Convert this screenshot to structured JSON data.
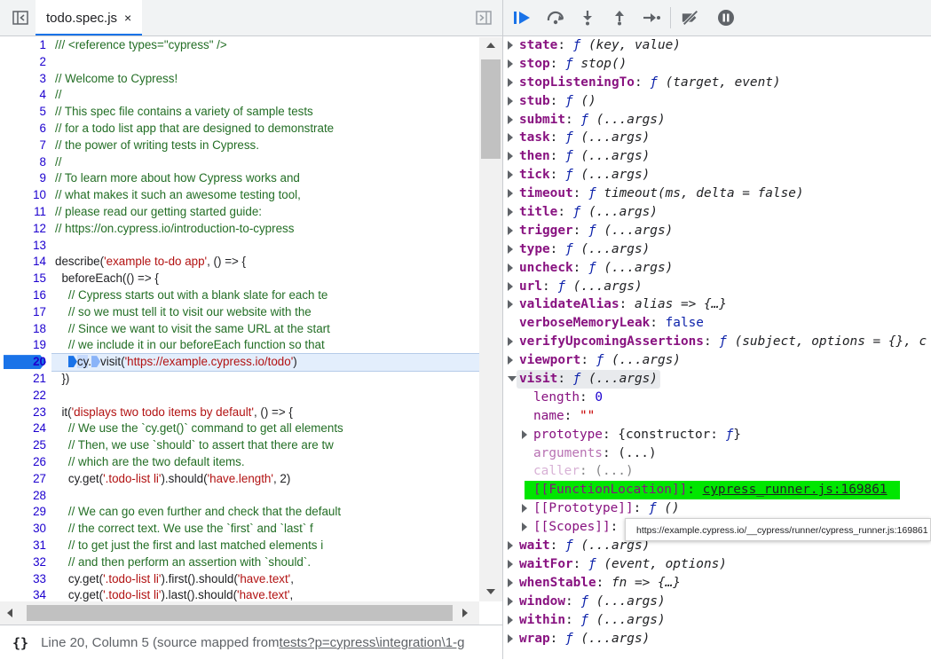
{
  "editor": {
    "tab_name": "todo.spec.js",
    "tab_close": "×",
    "breakpoint_line": 20,
    "lines": [
      {
        "n": "1",
        "parts": [
          {
            "t": "/// <reference types=\"cypress\" />",
            "c": "cm"
          }
        ]
      },
      {
        "n": "2",
        "parts": []
      },
      {
        "n": "3",
        "parts": [
          {
            "t": "// Welcome to Cypress!",
            "c": "cm"
          }
        ]
      },
      {
        "n": "4",
        "parts": [
          {
            "t": "//",
            "c": "cm"
          }
        ]
      },
      {
        "n": "5",
        "parts": [
          {
            "t": "// This spec file contains a variety of sample tests",
            "c": "cm"
          }
        ]
      },
      {
        "n": "6",
        "parts": [
          {
            "t": "// for a todo list app that are designed to demonstrate",
            "c": "cm"
          }
        ]
      },
      {
        "n": "7",
        "parts": [
          {
            "t": "// the power of writing tests in Cypress.",
            "c": "cm"
          }
        ]
      },
      {
        "n": "8",
        "parts": [
          {
            "t": "//",
            "c": "cm"
          }
        ]
      },
      {
        "n": "9",
        "parts": [
          {
            "t": "// To learn more about how Cypress works and",
            "c": "cm"
          }
        ]
      },
      {
        "n": "10",
        "parts": [
          {
            "t": "// what makes it such an awesome testing tool,",
            "c": "cm"
          }
        ]
      },
      {
        "n": "11",
        "parts": [
          {
            "t": "// please read our getting started guide:",
            "c": "cm"
          }
        ]
      },
      {
        "n": "12",
        "parts": [
          {
            "t": "// https://on.cypress.io/introduction-to-cypress",
            "c": "cm"
          }
        ]
      },
      {
        "n": "13",
        "parts": []
      },
      {
        "n": "14",
        "parts": [
          {
            "t": "describe(",
            "c": ""
          },
          {
            "t": "'example to-do app'",
            "c": "str"
          },
          {
            "t": ", () => {",
            "c": ""
          }
        ]
      },
      {
        "n": "15",
        "parts": [
          {
            "t": "  beforeEach(() => {",
            "c": ""
          }
        ]
      },
      {
        "n": "16",
        "parts": [
          {
            "t": "    // Cypress starts out with a blank slate for each te",
            "c": "cm"
          }
        ]
      },
      {
        "n": "17",
        "parts": [
          {
            "t": "    // so we must tell it to visit our website with the",
            "c": "cm"
          }
        ]
      },
      {
        "n": "18",
        "parts": [
          {
            "t": "    // Since we want to visit the same URL at the start",
            "c": "cm"
          }
        ]
      },
      {
        "n": "19",
        "parts": [
          {
            "t": "    // we include it in our beforeEach function so that",
            "c": "cm"
          }
        ]
      },
      {
        "n": "20",
        "parts": [
          {
            "t": "    ",
            "c": ""
          },
          {
            "t": "",
            "c": "marker hl"
          },
          {
            "t": "cy",
            "c": "hlcy"
          },
          {
            "t": ".",
            "c": ""
          },
          {
            "t": "",
            "c": "marker"
          },
          {
            "t": "visit(",
            "c": ""
          },
          {
            "t": "'https://example.cypress.io/todo'",
            "c": "str"
          },
          {
            "t": ")",
            "c": ""
          }
        ],
        "current": true
      },
      {
        "n": "21",
        "parts": [
          {
            "t": "  })",
            "c": ""
          }
        ]
      },
      {
        "n": "22",
        "parts": []
      },
      {
        "n": "23",
        "parts": [
          {
            "t": "  it(",
            "c": ""
          },
          {
            "t": "'displays two todo items by default'",
            "c": "str"
          },
          {
            "t": ", () => {",
            "c": ""
          }
        ]
      },
      {
        "n": "24",
        "parts": [
          {
            "t": "    // We use the `cy.get()` command to get all elements",
            "c": "cm"
          }
        ]
      },
      {
        "n": "25",
        "parts": [
          {
            "t": "    // Then, we use `should` to assert that there are tw",
            "c": "cm"
          }
        ]
      },
      {
        "n": "26",
        "parts": [
          {
            "t": "    // which are the two default items.",
            "c": "cm"
          }
        ]
      },
      {
        "n": "27",
        "parts": [
          {
            "t": "    cy.get(",
            "c": ""
          },
          {
            "t": "'.todo-list li'",
            "c": "str"
          },
          {
            "t": ").should(",
            "c": ""
          },
          {
            "t": "'have.length'",
            "c": "str"
          },
          {
            "t": ", 2)",
            "c": ""
          }
        ]
      },
      {
        "n": "28",
        "parts": []
      },
      {
        "n": "29",
        "parts": [
          {
            "t": "    // We can go even further and check that the default",
            "c": "cm"
          }
        ]
      },
      {
        "n": "30",
        "parts": [
          {
            "t": "    // the correct text. We use the `first` and `last` f",
            "c": "cm"
          }
        ]
      },
      {
        "n": "31",
        "parts": [
          {
            "t": "    // to get just the first and last matched elements i",
            "c": "cm"
          }
        ]
      },
      {
        "n": "32",
        "parts": [
          {
            "t": "    // and then perform an assertion with `should`.",
            "c": "cm"
          }
        ]
      },
      {
        "n": "33",
        "parts": [
          {
            "t": "    cy.get(",
            "c": ""
          },
          {
            "t": "'.todo-list li'",
            "c": "str"
          },
          {
            "t": ").first().should(",
            "c": ""
          },
          {
            "t": "'have.text'",
            "c": "str"
          },
          {
            "t": ", ",
            "c": ""
          }
        ]
      },
      {
        "n": "34",
        "parts": [
          {
            "t": "    cy.get(",
            "c": ""
          },
          {
            "t": "'.todo-list li'",
            "c": "str"
          },
          {
            "t": ").last().should(",
            "c": ""
          },
          {
            "t": "'have.text'",
            "c": "str"
          },
          {
            "t": ", ",
            "c": ""
          }
        ]
      }
    ]
  },
  "status": {
    "braces": "{}",
    "position": "Line 20, Column 5",
    "mapped_prefix": "(source mapped from ",
    "mapped_link": "tests?p=cypress\\integration\\1-g"
  },
  "scope": {
    "rows": [
      {
        "indent": 0,
        "tri": "r",
        "parts": [
          {
            "t": "state",
            "c": "k"
          },
          {
            "t": ": ",
            "c": ""
          },
          {
            "t": "ƒ",
            "c": "f"
          },
          {
            "t": " (key, value)",
            "c": "sig"
          }
        ]
      },
      {
        "indent": 0,
        "tri": "r",
        "parts": [
          {
            "t": "stop",
            "c": "k"
          },
          {
            "t": ": ",
            "c": ""
          },
          {
            "t": "ƒ",
            "c": "f"
          },
          {
            "t": " stop()",
            "c": "sig"
          }
        ]
      },
      {
        "indent": 0,
        "tri": "r",
        "parts": [
          {
            "t": "stopListeningTo",
            "c": "k"
          },
          {
            "t": ": ",
            "c": ""
          },
          {
            "t": "ƒ",
            "c": "f"
          },
          {
            "t": " (target, event)",
            "c": "sig"
          }
        ]
      },
      {
        "indent": 0,
        "tri": "r",
        "parts": [
          {
            "t": "stub",
            "c": "k"
          },
          {
            "t": ": ",
            "c": ""
          },
          {
            "t": "ƒ",
            "c": "f"
          },
          {
            "t": " ()",
            "c": "sig"
          }
        ]
      },
      {
        "indent": 0,
        "tri": "r",
        "parts": [
          {
            "t": "submit",
            "c": "k"
          },
          {
            "t": ": ",
            "c": ""
          },
          {
            "t": "ƒ",
            "c": "f"
          },
          {
            "t": " (...args)",
            "c": "sig"
          }
        ]
      },
      {
        "indent": 0,
        "tri": "r",
        "parts": [
          {
            "t": "task",
            "c": "k"
          },
          {
            "t": ": ",
            "c": ""
          },
          {
            "t": "ƒ",
            "c": "f"
          },
          {
            "t": " (...args)",
            "c": "sig"
          }
        ]
      },
      {
        "indent": 0,
        "tri": "r",
        "parts": [
          {
            "t": "then",
            "c": "k"
          },
          {
            "t": ": ",
            "c": ""
          },
          {
            "t": "ƒ",
            "c": "f"
          },
          {
            "t": " (...args)",
            "c": "sig"
          }
        ]
      },
      {
        "indent": 0,
        "tri": "r",
        "parts": [
          {
            "t": "tick",
            "c": "k"
          },
          {
            "t": ": ",
            "c": ""
          },
          {
            "t": "ƒ",
            "c": "f"
          },
          {
            "t": " (...args)",
            "c": "sig"
          }
        ]
      },
      {
        "indent": 0,
        "tri": "r",
        "parts": [
          {
            "t": "timeout",
            "c": "k"
          },
          {
            "t": ": ",
            "c": ""
          },
          {
            "t": "ƒ",
            "c": "f"
          },
          {
            "t": " timeout(ms, delta = false)",
            "c": "sig"
          }
        ]
      },
      {
        "indent": 0,
        "tri": "r",
        "parts": [
          {
            "t": "title",
            "c": "k"
          },
          {
            "t": ": ",
            "c": ""
          },
          {
            "t": "ƒ",
            "c": "f"
          },
          {
            "t": " (...args)",
            "c": "sig"
          }
        ]
      },
      {
        "indent": 0,
        "tri": "r",
        "parts": [
          {
            "t": "trigger",
            "c": "k"
          },
          {
            "t": ": ",
            "c": ""
          },
          {
            "t": "ƒ",
            "c": "f"
          },
          {
            "t": " (...args)",
            "c": "sig"
          }
        ]
      },
      {
        "indent": 0,
        "tri": "r",
        "parts": [
          {
            "t": "type",
            "c": "k"
          },
          {
            "t": ": ",
            "c": ""
          },
          {
            "t": "ƒ",
            "c": "f"
          },
          {
            "t": " (...args)",
            "c": "sig"
          }
        ]
      },
      {
        "indent": 0,
        "tri": "r",
        "parts": [
          {
            "t": "uncheck",
            "c": "k"
          },
          {
            "t": ": ",
            "c": ""
          },
          {
            "t": "ƒ",
            "c": "f"
          },
          {
            "t": " (...args)",
            "c": "sig"
          }
        ]
      },
      {
        "indent": 0,
        "tri": "r",
        "parts": [
          {
            "t": "url",
            "c": "k"
          },
          {
            "t": ": ",
            "c": ""
          },
          {
            "t": "ƒ",
            "c": "f"
          },
          {
            "t": " (...args)",
            "c": "sig"
          }
        ]
      },
      {
        "indent": 0,
        "tri": "r",
        "parts": [
          {
            "t": "validateAlias",
            "c": "k"
          },
          {
            "t": ": ",
            "c": ""
          },
          {
            "t": "alias => {…}",
            "c": "sig"
          }
        ]
      },
      {
        "indent": 0,
        "tri": "",
        "parts": [
          {
            "t": "verboseMemoryLeak",
            "c": "k"
          },
          {
            "t": ": ",
            "c": ""
          },
          {
            "t": "false",
            "c": "kw"
          }
        ]
      },
      {
        "indent": 0,
        "tri": "r",
        "parts": [
          {
            "t": "verifyUpcomingAssertions",
            "c": "k"
          },
          {
            "t": ": ",
            "c": ""
          },
          {
            "t": "ƒ",
            "c": "f"
          },
          {
            "t": " (subject, options = {}, c",
            "c": "sig"
          }
        ]
      },
      {
        "indent": 0,
        "tri": "r",
        "parts": [
          {
            "t": "viewport",
            "c": "k"
          },
          {
            "t": ": ",
            "c": ""
          },
          {
            "t": "ƒ",
            "c": "f"
          },
          {
            "t": " (...args)",
            "c": "sig"
          }
        ]
      },
      {
        "indent": 0,
        "tri": "d",
        "hover": true,
        "parts": [
          {
            "t": "visit",
            "c": "k"
          },
          {
            "t": ": ",
            "c": ""
          },
          {
            "t": "ƒ",
            "c": "f"
          },
          {
            "t": " (...args)",
            "c": "sig"
          }
        ]
      },
      {
        "indent": 1,
        "tri": "",
        "parts": [
          {
            "t": "length",
            "c": "k n"
          },
          {
            "t": ": ",
            "c": ""
          },
          {
            "t": "0",
            "c": "num"
          }
        ]
      },
      {
        "indent": 1,
        "tri": "",
        "parts": [
          {
            "t": "name",
            "c": "k n"
          },
          {
            "t": ": ",
            "c": ""
          },
          {
            "t": "\"\"",
            "c": "strv"
          }
        ]
      },
      {
        "indent": 1,
        "tri": "r",
        "parts": [
          {
            "t": "prototype",
            "c": "k n"
          },
          {
            "t": ": {constructor: ",
            "c": ""
          },
          {
            "t": "ƒ",
            "c": "f"
          },
          {
            "t": "}",
            "c": ""
          }
        ]
      },
      {
        "indent": 1,
        "tri": "",
        "parts": [
          {
            "t": "arguments",
            "c": "k dim"
          },
          {
            "t": ": (...)",
            "c": ""
          }
        ]
      },
      {
        "indent": 1,
        "tri": "",
        "dim": true,
        "parts": [
          {
            "t": "caller",
            "c": "k dim"
          },
          {
            "t": ": (...)",
            "c": ""
          }
        ]
      },
      {
        "indent": 1,
        "tri": "",
        "green": true,
        "parts": [
          {
            "t": "[[FunctionLocation]]",
            "c": "k n"
          },
          {
            "t": ": ",
            "c": ""
          },
          {
            "t": "cypress_runner.js:169861",
            "c": "ul"
          }
        ]
      },
      {
        "indent": 1,
        "tri": "r",
        "parts": [
          {
            "t": "[[Prototype]]",
            "c": "k n"
          },
          {
            "t": ": ",
            "c": ""
          },
          {
            "t": "ƒ",
            "c": "f"
          },
          {
            "t": " ()",
            "c": "sig"
          }
        ]
      },
      {
        "indent": 1,
        "tri": "r",
        "parts": [
          {
            "t": "[[Scopes]]",
            "c": "k n"
          },
          {
            "t": ": ",
            "c": ""
          }
        ]
      },
      {
        "indent": 0,
        "tri": "r",
        "parts": [
          {
            "t": "wait",
            "c": "k"
          },
          {
            "t": ": ",
            "c": ""
          },
          {
            "t": "ƒ",
            "c": "f"
          },
          {
            "t": " (...args)",
            "c": "sig"
          }
        ]
      },
      {
        "indent": 0,
        "tri": "r",
        "parts": [
          {
            "t": "waitFor",
            "c": "k"
          },
          {
            "t": ": ",
            "c": ""
          },
          {
            "t": "ƒ",
            "c": "f"
          },
          {
            "t": " (event, options)",
            "c": "sig"
          }
        ]
      },
      {
        "indent": 0,
        "tri": "r",
        "parts": [
          {
            "t": "whenStable",
            "c": "k"
          },
          {
            "t": ": ",
            "c": ""
          },
          {
            "t": "fn => {…}",
            "c": "sig"
          }
        ]
      },
      {
        "indent": 0,
        "tri": "r",
        "parts": [
          {
            "t": "window",
            "c": "k"
          },
          {
            "t": ": ",
            "c": ""
          },
          {
            "t": "ƒ",
            "c": "f"
          },
          {
            "t": " (...args)",
            "c": "sig"
          }
        ]
      },
      {
        "indent": 0,
        "tri": "r",
        "parts": [
          {
            "t": "within",
            "c": "k"
          },
          {
            "t": ": ",
            "c": ""
          },
          {
            "t": "ƒ",
            "c": "f"
          },
          {
            "t": " (...args)",
            "c": "sig"
          }
        ]
      },
      {
        "indent": 0,
        "tri": "r",
        "parts": [
          {
            "t": "wrap",
            "c": "k"
          },
          {
            "t": ": ",
            "c": ""
          },
          {
            "t": "ƒ",
            "c": "f"
          },
          {
            "t": " (...args)",
            "c": "sig"
          }
        ]
      }
    ]
  },
  "tooltip": "https://example.cypress.io/__cypress/runner/cypress_runner.js:169861",
  "debug_buttons": [
    "resume-icon",
    "step-over-icon",
    "step-into-icon",
    "step-out-icon",
    "step-icon",
    "deactivate-breakpoints-icon",
    "pause-on-exceptions-icon"
  ],
  "colors": {
    "accent": "#1a73e8",
    "highlight": "#00e600",
    "keyword": "#881280",
    "string": "#b21212",
    "comment": "#236e25"
  }
}
